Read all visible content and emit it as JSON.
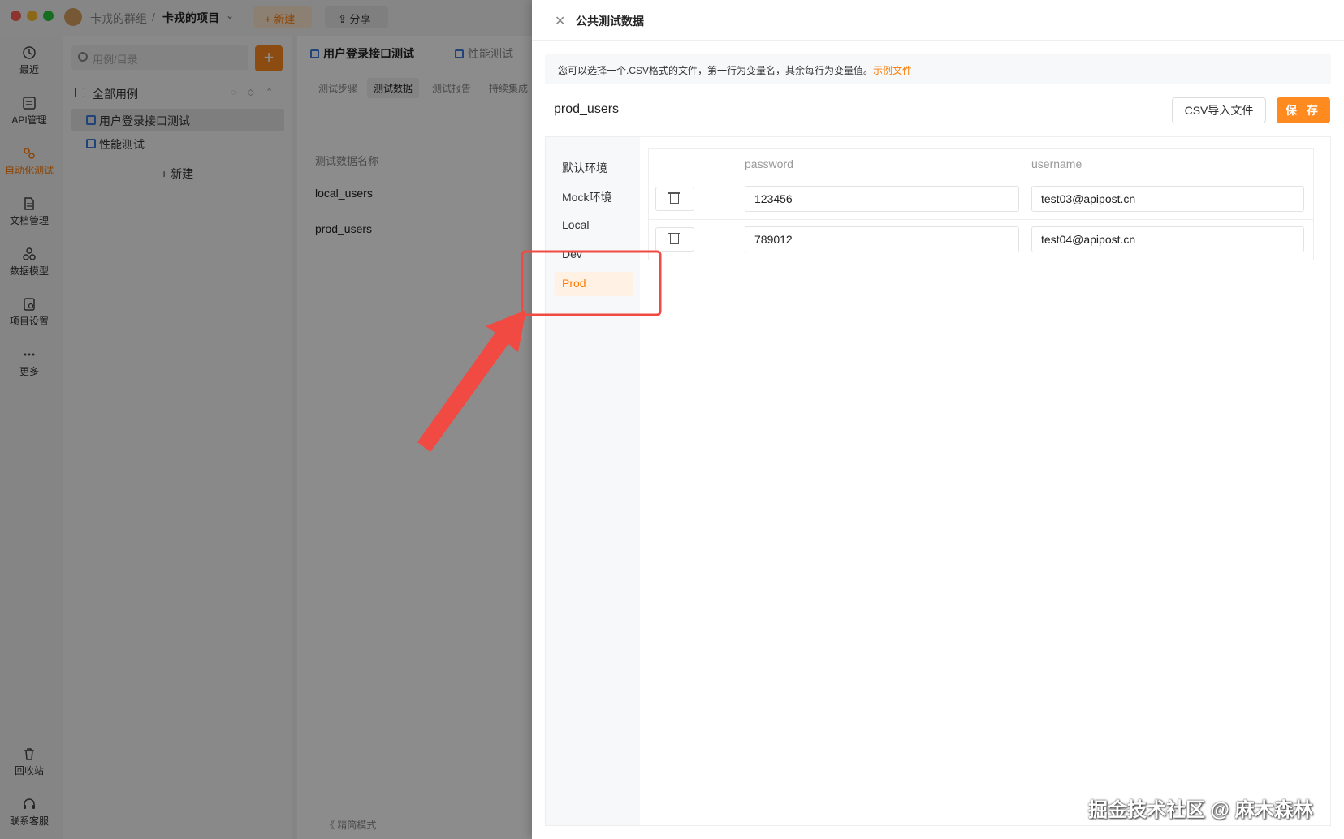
{
  "titlebar": {
    "group": "卡戎的群组",
    "separator": "/",
    "project": "卡戎的项目",
    "new_label": "+ 新建",
    "share_label": "分享"
  },
  "leftnav": {
    "items": [
      {
        "label": "最近",
        "icon": "clock-icon"
      },
      {
        "label": "API管理",
        "icon": "api-icon"
      },
      {
        "label": "自动化测试",
        "icon": "automation-icon"
      },
      {
        "label": "文档管理",
        "icon": "document-icon"
      },
      {
        "label": "数据模型",
        "icon": "data-model-icon"
      },
      {
        "label": "项目设置",
        "icon": "project-settings-icon"
      },
      {
        "label": "更多",
        "icon": "more-icon"
      }
    ],
    "bottom": [
      {
        "label": "回收站",
        "icon": "trash-icon"
      },
      {
        "label": "联系客服",
        "icon": "headset-icon"
      }
    ]
  },
  "tree": {
    "search_placeholder": "用例/目录",
    "root_label": "全部用例",
    "items": [
      "用户登录接口测试",
      "性能测试"
    ],
    "new_label": "+ 新建"
  },
  "main": {
    "tabs": [
      "用户登录接口测试",
      "性能测试"
    ],
    "subtabs": [
      "测试步骤",
      "测试数据",
      "测试报告",
      "持续集成"
    ],
    "list_header": "测试数据名称",
    "rows": [
      "local_users",
      "prod_users"
    ],
    "footer": "《 精简模式"
  },
  "drawer": {
    "title": "公共测试数据",
    "hint": "您可以选择一个.CSV格式的文件，第一行为变量名，其余每行为变量值。",
    "hint_link": "示例文件",
    "name": "prod_users",
    "csv_button": "CSV导入文件",
    "save_button": "保 存",
    "envs": [
      "默认环境",
      "Mock环境",
      "Local",
      "Dev",
      "Prod"
    ],
    "active_env": "Prod",
    "columns": [
      "password",
      "username"
    ],
    "rows": [
      {
        "password": "123456",
        "username": "test03@apipost.cn"
      },
      {
        "password": "789012",
        "username": "test04@apipost.cn"
      }
    ]
  },
  "watermark": "掘金技术社区 @ 麻木森林",
  "colors": {
    "accent": "#ff8a1f",
    "annotation": "#f04a43"
  }
}
